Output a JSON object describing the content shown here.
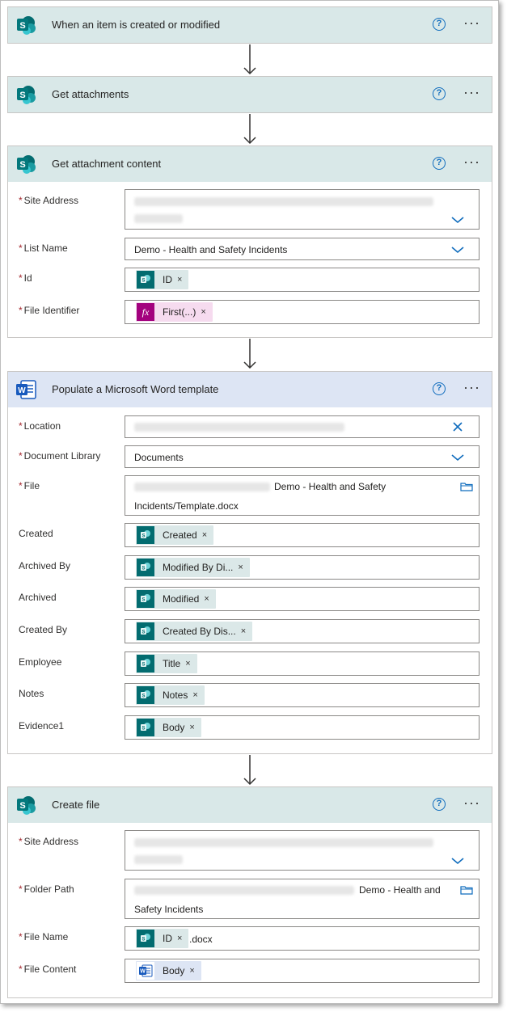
{
  "steps": {
    "trigger": {
      "title": "When an item is created or modified"
    },
    "get_attachments": {
      "title": "Get attachments"
    },
    "get_content": {
      "title": "Get attachment content",
      "fields": {
        "site_address": {
          "label": "Site Address"
        },
        "list_name": {
          "label": "List Name",
          "value": "Demo - Health and Safety Incidents"
        },
        "id": {
          "label": "Id",
          "token": "ID"
        },
        "file_identifier": {
          "label": "File Identifier",
          "token": "First(...)"
        }
      }
    },
    "populate": {
      "title": "Populate a Microsoft Word template",
      "fields": {
        "location": {
          "label": "Location"
        },
        "document_library": {
          "label": "Document Library",
          "value": "Documents"
        },
        "file": {
          "label": "File",
          "value_line1": "Demo - Health and Safety",
          "value_line2": "Incidents/Template.docx"
        },
        "created": {
          "label": "Created",
          "token": "Created"
        },
        "archived_by": {
          "label": "Archived By",
          "token": "Modified By Di..."
        },
        "archived": {
          "label": "Archived",
          "token": "Modified"
        },
        "created_by": {
          "label": "Created By",
          "token": "Created By Dis..."
        },
        "employee": {
          "label": "Employee",
          "token": "Title"
        },
        "notes": {
          "label": "Notes",
          "token": "Notes"
        },
        "evidence1": {
          "label": "Evidence1",
          "token": "Body"
        }
      }
    },
    "create_file": {
      "title": "Create file",
      "fields": {
        "site_address": {
          "label": "Site Address"
        },
        "folder_path": {
          "label": "Folder Path",
          "value_line1": "Demo - Health and",
          "value_line2": "Safety Incidents"
        },
        "file_name": {
          "label": "File Name",
          "token": "ID",
          "suffix": ".docx"
        },
        "file_content": {
          "label": "File Content",
          "token": "Body"
        }
      }
    }
  },
  "common": {
    "required_mark": "*",
    "help": "?",
    "more": "···",
    "remove": "×"
  },
  "icons": {
    "sharepoint": "sharepoint-icon",
    "word": "word-icon",
    "expression": "fx-icon"
  },
  "colors": {
    "sharepoint": "#036c70",
    "word": "#185abd",
    "expression": "#a3017e",
    "accent": "#0f6cbd",
    "required": "#a4262c"
  }
}
